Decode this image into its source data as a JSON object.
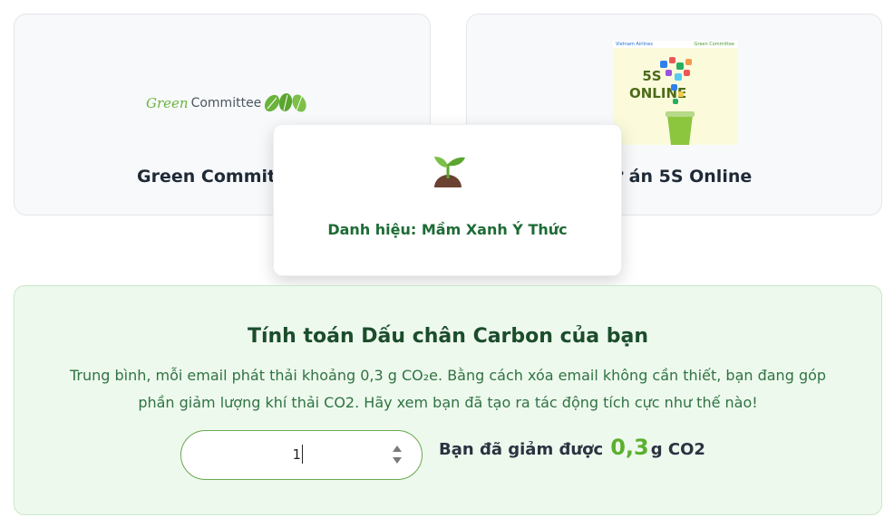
{
  "cards": [
    {
      "title": "Green Committee",
      "logo": {
        "green": "Green",
        "committee": "Committee"
      }
    },
    {
      "title": "Dự án 5S Online",
      "thumbnail": {
        "brand": "Vietnam Airlines",
        "brand_right": "Green Committee",
        "headline": "5S ONLINE"
      }
    }
  ],
  "popup": {
    "icon": "sprout-icon",
    "title": "Danh hiệu: Mầm Xanh Ý Thức"
  },
  "calculator": {
    "title": "Tính toán Dấu chân Carbon của bạn",
    "description": "Trung bình, mỗi email phát thải khoảng 0,3 g CO₂e. Bằng cách xóa email không cần thiết, bạn đang góp phần giảm lượng khí thải CO2. Hãy xem bạn đã tạo ra tác động tích cực như thế nào!",
    "input_value": "1",
    "result_prefix": "Bạn đã giảm được",
    "result_value": "0,3",
    "result_unit": "g CO2"
  },
  "colors": {
    "accent_green": "#5bb02f",
    "dark_green": "#1b4d2c",
    "card_bg": "#f8f9fb",
    "calc_bg": "#eef9ee"
  }
}
